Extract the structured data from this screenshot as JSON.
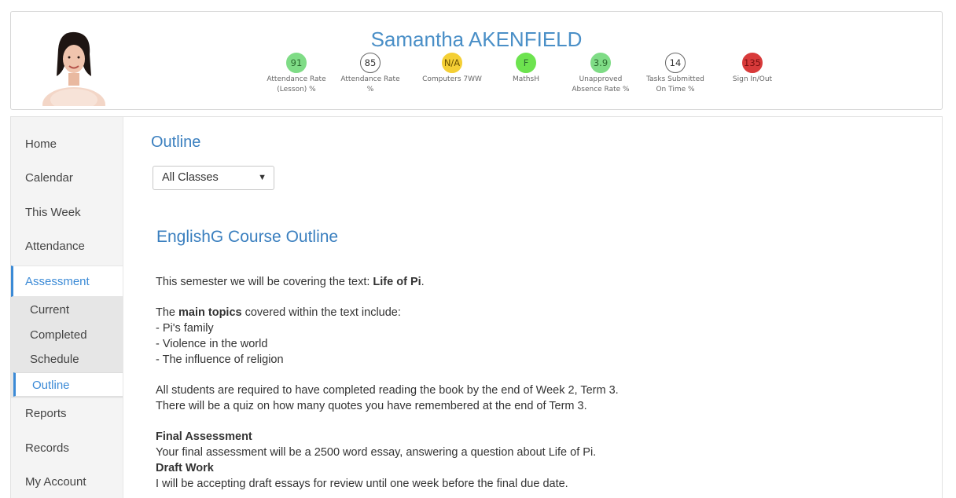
{
  "profile": {
    "name": "Samantha AKENFIELD",
    "stats": [
      {
        "value": "91",
        "label_line1": "Attendance Rate",
        "label_line2": "(Lesson) %",
        "color": "#7fdc86"
      },
      {
        "value": "85",
        "label_line1": "Attendance Rate",
        "label_line2": "%",
        "color": "#ffffff"
      },
      {
        "value": "N/A",
        "label_line1": "Computers 7WW",
        "label_line2": "",
        "color": "#f4cf35"
      },
      {
        "value": "F",
        "label_line1": "MathsH",
        "label_line2": "",
        "color": "#6de34f"
      },
      {
        "value": "3.9",
        "label_line1": "Unapproved",
        "label_line2": "Absence Rate %",
        "color": "#7fdc86"
      },
      {
        "value": "14",
        "label_line1": "Tasks Submitted",
        "label_line2": "On Time %",
        "color": "#ffffff"
      },
      {
        "value": "135",
        "label_line1": "Sign In/Out",
        "label_line2": "",
        "color": "#d83a3a"
      }
    ]
  },
  "sidebar": {
    "items": [
      {
        "label": "Home"
      },
      {
        "label": "Calendar"
      },
      {
        "label": "This Week"
      },
      {
        "label": "Attendance"
      },
      {
        "label": "Assessment"
      },
      {
        "label": "Reports"
      },
      {
        "label": "Records"
      },
      {
        "label": "My Account"
      }
    ],
    "sub_items": [
      {
        "label": "Current"
      },
      {
        "label": "Completed"
      },
      {
        "label": "Schedule"
      },
      {
        "label": "Outline"
      }
    ],
    "active_item": "Assessment",
    "active_sub_item": "Outline"
  },
  "main": {
    "title": "Outline",
    "class_select": {
      "selected": "All Classes"
    },
    "course_title": "EnglishG Course Outline",
    "content": {
      "intro_prefix": "This semester we will be covering the text: ",
      "intro_book": "Life of Pi",
      "intro_suffix": ".",
      "topics_prefix": "The ",
      "topics_bold": "main topics",
      "topics_suffix": " covered within the text include:",
      "topics": [
        "- Pi's family",
        "- Violence in the world",
        "- The influence of religion"
      ],
      "reading_line1": "All students are required to have completed reading the book by the end of Week 2, Term 3.",
      "reading_line2": "There will be a quiz on how many quotes you have remembered at the end of Term 3.",
      "final_heading": "Final Assessment",
      "final_text": "Your final assessment will be a 2500 word essay, answering a question about Life of Pi.",
      "draft_heading": "Draft Work",
      "draft_text": "I will be accepting draft essays for review until one week before the final due date."
    }
  },
  "colors": {
    "accent": "#3b8ad6",
    "title_blue": "#3a7fbf"
  }
}
